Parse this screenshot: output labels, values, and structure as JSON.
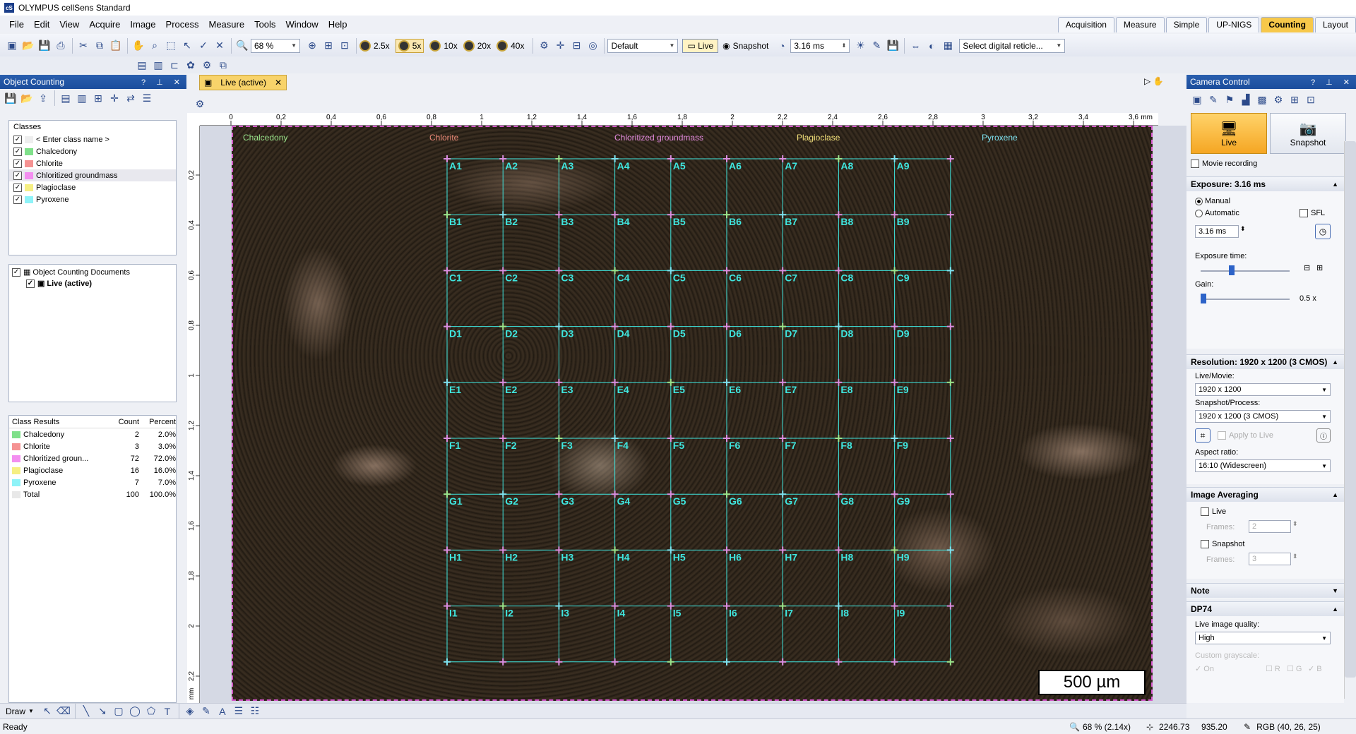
{
  "app": {
    "title": "OLYMPUS cellSens Standard",
    "icon": "cS"
  },
  "menu": [
    "File",
    "Edit",
    "View",
    "Acquire",
    "Image",
    "Process",
    "Measure",
    "Tools",
    "Window",
    "Help"
  ],
  "layout_tabs": [
    {
      "label": "Acquisition",
      "active": false
    },
    {
      "label": "Measure",
      "active": false
    },
    {
      "label": "Simple",
      "active": false
    },
    {
      "label": "UP-NIGS",
      "active": false
    },
    {
      "label": "Counting",
      "active": true
    },
    {
      "label": "Layout",
      "active": false
    }
  ],
  "toolbar": {
    "zoom": "68 %",
    "objectives": [
      "2.5x",
      "5x",
      "10x",
      "20x",
      "40x"
    ],
    "preset": "Default",
    "live_label": "Live",
    "snapshot_label": "Snapshot",
    "exposure": "3.16 ms",
    "reticle": "Select digital reticle..."
  },
  "object_counting": {
    "title": "Object Counting",
    "classes_header": "Classes",
    "enter_class": "< Enter class name >",
    "classes": [
      {
        "name": "Chalcedony",
        "color": "#7fe08a"
      },
      {
        "name": "Chlorite",
        "color": "#f59292"
      },
      {
        "name": "Chloritized groundmass",
        "color": "#f38ef0"
      },
      {
        "name": "Plagioclase",
        "color": "#f6ef83"
      },
      {
        "name": "Pyroxene",
        "color": "#8ef3f8"
      }
    ],
    "docs_title": "Object Counting Documents",
    "doc_item": "Live (active)",
    "results": {
      "col_class": "Class Results",
      "col_count": "Count",
      "col_percent": "Percent",
      "rows": [
        {
          "name": "Chalcedony",
          "count": "2",
          "percent": "2.0%",
          "color": "#7fe08a"
        },
        {
          "name": "Chlorite",
          "count": "3",
          "percent": "3.0%",
          "color": "#f59292"
        },
        {
          "name": "Chloritized groun...",
          "count": "72",
          "percent": "72.0%",
          "color": "#f38ef0"
        },
        {
          "name": "Plagioclase",
          "count": "16",
          "percent": "16.0%",
          "color": "#f6ef83"
        },
        {
          "name": "Pyroxene",
          "count": "7",
          "percent": "7.0%",
          "color": "#8ef3f8"
        },
        {
          "name": "Total",
          "count": "100",
          "percent": "100.0%",
          "color": ""
        }
      ]
    }
  },
  "document_tab": "Live (active)",
  "ruler": {
    "unit": "mm",
    "h_ticks": [
      "0",
      "0,2",
      "0,4",
      "0,6",
      "0,8",
      "1",
      "1,2",
      "1,4",
      "1,6",
      "1,8",
      "2",
      "2,2",
      "2,4",
      "2,6",
      "2,8",
      "3",
      "3,2",
      "3,4",
      "3,6"
    ],
    "v_ticks": [
      "0,2",
      "0,4",
      "0,6",
      "0,8",
      "1",
      "1,2",
      "1,4",
      "1,6",
      "1,8",
      "2",
      "2,2"
    ]
  },
  "image": {
    "class_labels": [
      {
        "name": "Chalcedony",
        "color": "#9be58c"
      },
      {
        "name": "Chlorite",
        "color": "#f08c7a"
      },
      {
        "name": "Chloritized groundmass",
        "color": "#e58ce0"
      },
      {
        "name": "Plagioclase",
        "color": "#f2e07a"
      },
      {
        "name": "Pyroxene",
        "color": "#7de2f0"
      }
    ],
    "grid_rows": [
      "A",
      "B",
      "C",
      "D",
      "E",
      "F",
      "G",
      "H",
      "I"
    ],
    "grid_cols": [
      "1",
      "2",
      "3",
      "4",
      "5",
      "6",
      "7",
      "8",
      "9"
    ],
    "grid_color": "#3fe6df",
    "scale_bar": "500 µm"
  },
  "camera": {
    "title": "Camera Control",
    "live": "Live",
    "snapshot": "Snapshot",
    "movie": "Movie recording",
    "exposure_head": "Exposure: 3.16 ms",
    "manual": "Manual",
    "automatic": "Automatic",
    "sfl": "SFL",
    "exposure_value": "3.16 ms",
    "exposure_time": "Exposure time:",
    "gain": "Gain:",
    "gain_value": "0.5 x",
    "resolution_head": "Resolution: 1920 x 1200 (3 CMOS)",
    "live_movie": "Live/Movie:",
    "live_movie_val": "1920 x 1200",
    "snap_proc": "Snapshot/Process:",
    "snap_proc_val": "1920 x 1200 (3 CMOS)",
    "apply_live": "Apply to Live",
    "aspect": "Aspect ratio:",
    "aspect_val": "16:10 (Widescreen)",
    "avg_head": "Image Averaging",
    "avg_live": "Live",
    "frames": "Frames:",
    "frames_live": "2",
    "avg_snap": "Snapshot",
    "frames_snap": "3",
    "note": "Note",
    "dp74": "DP74",
    "quality": "Live image quality:",
    "quality_val": "High",
    "custom_gray": "Custom grayscale:",
    "on": "On",
    "r": "R",
    "g": "G",
    "b": "B"
  },
  "drawbar": {
    "draw": "Draw"
  },
  "status": {
    "text": "Ready",
    "zoom": "68 % (2.14x)",
    "coord_x": "2246.73",
    "coord_y": "935.20",
    "rgb": "RGB (40, 26, 25)"
  }
}
